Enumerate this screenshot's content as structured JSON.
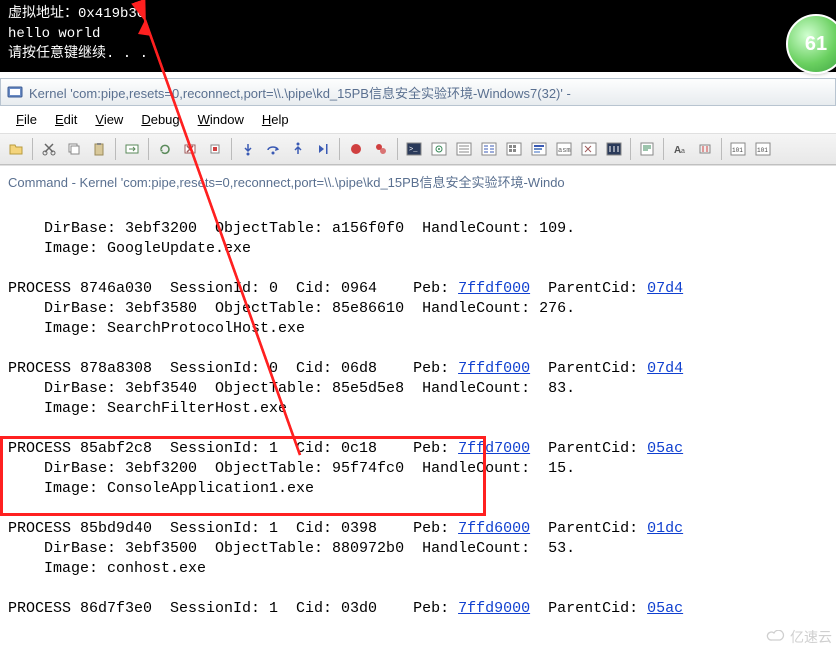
{
  "console": {
    "line1": "虚拟地址：0x419b30",
    "line2": "hello world",
    "line3": "请按任意键继续. . ."
  },
  "badge": "61",
  "titlebar": {
    "text": "Kernel 'com:pipe,resets=0,reconnect,port=\\\\.\\pipe\\kd_15PB信息安全实验环境-Windows7(32)' -"
  },
  "menu": {
    "file": "File",
    "edit": "Edit",
    "view": "View",
    "debug": "Debug",
    "window": "Window",
    "help": "Help"
  },
  "cmd_title": "Command - Kernel 'com:pipe,resets=0,reconnect,port=\\\\.\\pipe\\kd_15PB信息安全实验环境-Windo",
  "processes": [
    {
      "line1": "    DirBase: 3ebf3200  ObjectTable: a156f0f0  HandleCount: 109.",
      "line2": "    Image: GoogleUpdate.exe"
    },
    {
      "headA": "PROCESS 8746a030  SessionId: 0  Cid: 0964    Peb: ",
      "peb": "7ffdf000",
      "headB": "  ParentCid: ",
      "parent": "07d4",
      "line1": "    DirBase: 3ebf3580  ObjectTable: 85e86610  HandleCount: 276.",
      "line2": "    Image: SearchProtocolHost.exe"
    },
    {
      "headA": "PROCESS 878a8308  SessionId: 0  Cid: 06d8    Peb: ",
      "peb": "7ffdf000",
      "headB": "  ParentCid: ",
      "parent": "07d4",
      "line1": "    DirBase: 3ebf3540  ObjectTable: 85e5d5e8  HandleCount:  83.",
      "line2": "    Image: SearchFilterHost.exe"
    },
    {
      "headA": "PROCESS 85abf2c8  SessionId: 1  Cid: 0c18    Peb: ",
      "peb": "7ffd7000",
      "headB": "  ParentCid: ",
      "parent": "05ac",
      "line1": "    DirBase: 3ebf3200  ObjectTable: 95f74fc0  HandleCount:  15.",
      "line2": "    Image: ConsoleApplication1.exe"
    },
    {
      "headA": "PROCESS 85bd9d40  SessionId: 1  Cid: 0398    Peb: ",
      "peb": "7ffd6000",
      "headB": "  ParentCid: ",
      "parent": "01dc",
      "line1": "    DirBase: 3ebf3500  ObjectTable: 880972b0  HandleCount:  53.",
      "line2": "    Image: conhost.exe"
    },
    {
      "headA": "PROCESS 86d7f3e0  SessionId: 1  Cid: 03d0    Peb: ",
      "peb": "7ffd9000",
      "headB": "  ParentCid: ",
      "parent": "05ac"
    }
  ],
  "watermark": "亿速云"
}
